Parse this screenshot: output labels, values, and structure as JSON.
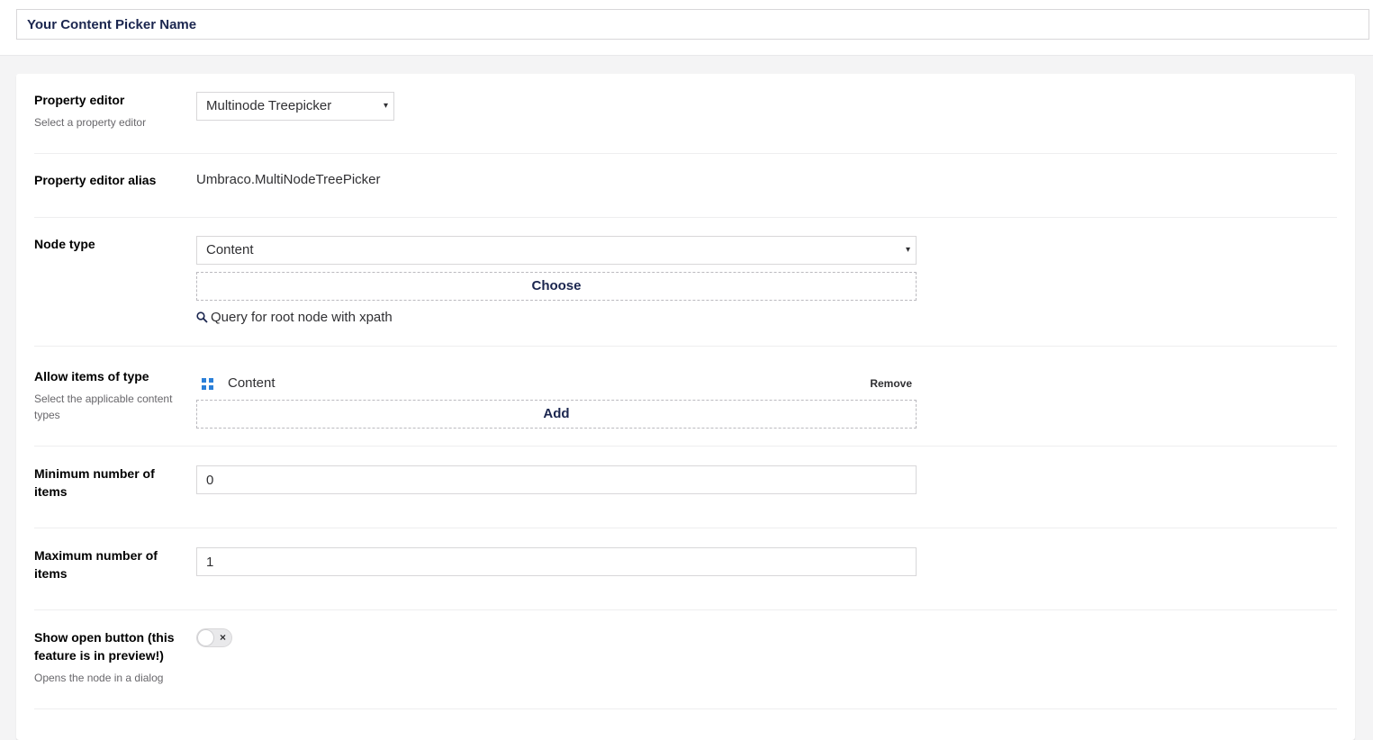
{
  "header": {
    "name_value": "Your Content Picker Name"
  },
  "property_editor": {
    "label": "Property editor",
    "description": "Select a property editor",
    "selected": "Multinode Treepicker"
  },
  "property_editor_alias": {
    "label": "Property editor alias",
    "value": "Umbraco.MultiNodeTreePicker"
  },
  "node_type": {
    "label": "Node type",
    "selected": "Content",
    "choose_label": "Choose",
    "query_label": "Query for root node with xpath"
  },
  "allow_items": {
    "label": "Allow items of type",
    "description": "Select the applicable content types",
    "items": [
      {
        "name": "Content",
        "icon": "grid-icon",
        "remove_label": "Remove"
      }
    ],
    "add_label": "Add"
  },
  "minimum_items": {
    "label": "Minimum number of items",
    "value": "0"
  },
  "maximum_items": {
    "label": "Maximum number of items",
    "value": "1"
  },
  "show_open_button": {
    "label": "Show open button (this feature is in preview!)",
    "description": "Opens the node in a dialog",
    "enabled": false,
    "toggle_symbol": "×"
  },
  "icons": {
    "caret": "▾",
    "search": "search-icon",
    "accent_color": "#2b80d9"
  }
}
